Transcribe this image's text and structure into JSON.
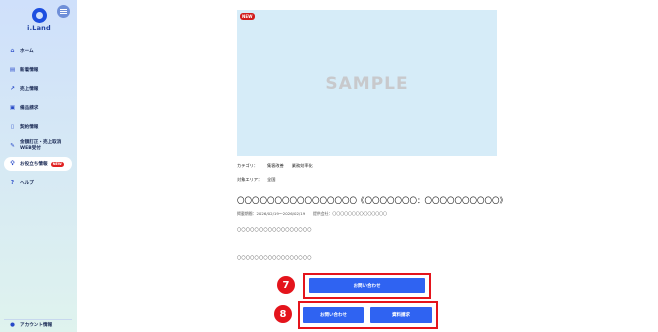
{
  "sidebar": {
    "logo_text": "i.Land",
    "items": [
      {
        "label": "ホーム",
        "icon": "home-icon"
      },
      {
        "label": "新着情報",
        "icon": "news-icon"
      },
      {
        "label": "売上情報",
        "icon": "sales-chart-icon"
      },
      {
        "label": "備品請求",
        "icon": "supplies-icon"
      },
      {
        "label": "契約情報",
        "icon": "contract-icon"
      },
      {
        "label_line1": "金額訂正・売上取消",
        "label_line2": "WEB受付",
        "icon": "correction-icon"
      },
      {
        "label": "お役立ち情報",
        "icon": "lightbulb-icon",
        "badge": "NEW"
      },
      {
        "label": "ヘルプ",
        "icon": "help-icon"
      }
    ],
    "account_label": "アカウント情報"
  },
  "article": {
    "image_badge": "NEW",
    "image_placeholder": "SAMPLE",
    "category_label": "カテゴリ：",
    "categories": [
      "集客改善",
      "業務効率化"
    ],
    "area_label": "対象エリア：",
    "area_value": "全国",
    "headline": "〇〇〇〇〇〇〇〇〇〇〇〇〇〇〇〇《〇〇〇〇〇〇〇：〇〇〇〇〇〇〇〇〇〇》",
    "subline": "掲載期間：2026/02/19～2026/02/19　　提供会社：〇〇〇〇〇〇〇〇〇〇〇〇〇〇",
    "body_line1": "〇〇〇〇〇〇〇〇〇〇〇〇〇〇〇〇〇",
    "body_line2": "〇〇〇〇〇〇〇〇〇〇〇〇〇〇〇〇〇"
  },
  "cta": {
    "step7": "7",
    "step8": "8",
    "single_inquiry": "お問い合わせ",
    "pair_inquiry": "お問い合わせ",
    "pair_request": "資料請求"
  },
  "colors": {
    "accent": "#2f63f2",
    "highlight": "#e4141c",
    "sidebar_top": "#cfe0fb",
    "image_bg": "#d6ecf8"
  }
}
